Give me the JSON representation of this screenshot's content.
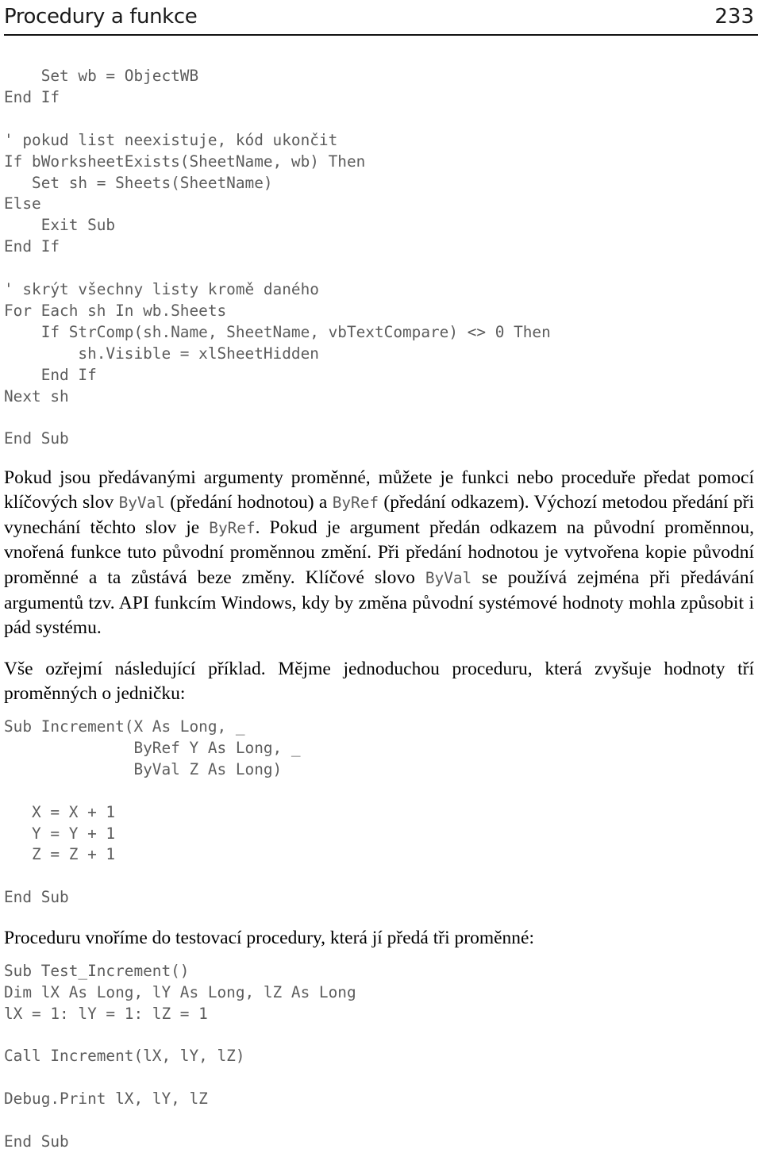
{
  "header": {
    "title": "Procedury a funkce",
    "folio": "233"
  },
  "code_block_1": [
    "    Set wb = ObjectWB",
    "End If",
    "",
    "' pokud list neexistuje, kód ukončit",
    "If bWorksheetExists(SheetName, wb) Then",
    "   Set sh = Sheets(SheetName)",
    "Else",
    "    Exit Sub",
    "End If",
    "",
    "' skrýt všechny listy kromě daného",
    "For Each sh In wb.Sheets",
    "    If StrComp(sh.Name, SheetName, vbTextCompare) <> 0 Then",
    "        sh.Visible = xlSheetHidden",
    "    End If",
    "Next sh",
    "",
    "End Sub"
  ],
  "paragraph_1": {
    "run_1": "Pokud jsou předávanými argumenty proměnné, můžete je funkci nebo proceduře předat pomocí klíčových slov ",
    "code_1": "ByVal",
    "run_2": " (předání hodnotou) a ",
    "code_2": "ByRef",
    "run_3": " (předání odkazem). Výchozí metodou předání při vynechání těchto slov je ",
    "code_3": "ByRef",
    "run_4": ". Pokud je argument předán odkazem na původní proměnnou, vnořená funkce tuto původní proměnnou změní. Při předání hodnotou je vytvořena kopie původní proměnné a ta zůstává beze změny. Klíčové slovo ",
    "code_4": "ByVal",
    "run_5": " se používá zejména při předávání argumentů tzv. API funkcím Windows, kdy by změna původní systémové hodnoty mohla způsobit i pád systému."
  },
  "paragraph_2": {
    "text": "Vše ozřejmí následující příklad. Mějme jednoduchou proceduru, která zvyšuje hodnoty tří proměnných o jedničku:"
  },
  "code_block_2": [
    "Sub Increment(X As Long, _",
    "              ByRef Y As Long, _",
    "              ByVal Z As Long)",
    "",
    "   X = X + 1",
    "   Y = Y + 1",
    "   Z = Z + 1",
    "",
    "End Sub"
  ],
  "paragraph_3": {
    "text": "Proceduru vnoříme do testovací procedury, která jí předá tři proměnné:"
  },
  "code_block_3": [
    "Sub Test_Increment()",
    "Dim lX As Long, lY As Long, lZ As Long",
    "lX = 1: lY = 1: lZ = 1",
    "",
    "Call Increment(lX, lY, lZ)",
    "",
    "Debug.Print lX, lY, lZ",
    "",
    "End Sub"
  ],
  "colors": {
    "body_text": "#000000",
    "code_text": "#5c5c5c",
    "rule": "#111111",
    "background": "#ffffff"
  }
}
